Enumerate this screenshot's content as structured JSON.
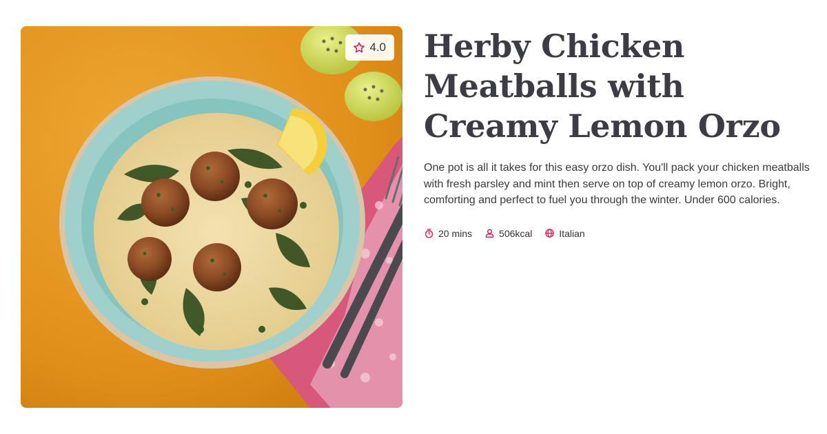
{
  "recipe": {
    "title": "Herby Chicken Meatballs with Creamy Lemon Orzo",
    "description": "One pot is all it takes for this easy orzo dish. You'll pack your chicken meatballs with fresh parsley and mint then serve on top of creamy lemon orzo. Bright, comforting and perfect to fuel you through the winter. Under 600 calories.",
    "rating": "4.0",
    "meta": {
      "time": "20 mins",
      "calories": "506kcal",
      "cuisine": "Italian"
    }
  },
  "icons": {
    "rating": "star-icon",
    "time": "stopwatch-icon",
    "calories": "person-icon",
    "cuisine": "globe-icon"
  },
  "colors": {
    "accent": "#e0134b",
    "title": "#3c3c44",
    "text": "#3a3a3a"
  }
}
